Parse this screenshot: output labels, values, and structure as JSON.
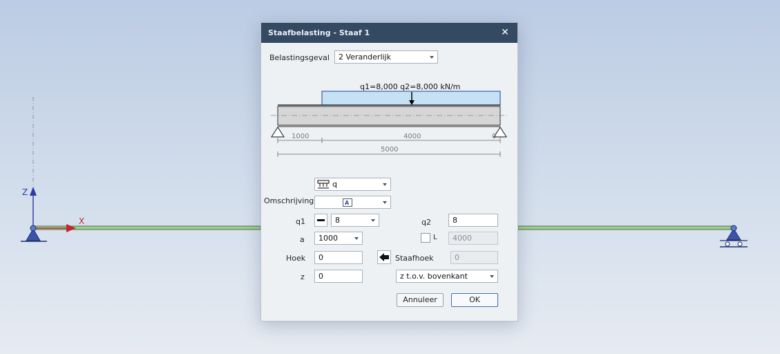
{
  "dialog": {
    "title": "Staafbelasting - Staaf 1",
    "close_label": "✕"
  },
  "scene": {
    "axis_x": "X",
    "axis_z": "Z"
  },
  "form": {
    "belastingsgeval_label": "Belastingsgeval",
    "belastingsgeval_value": "2 Veranderlijk",
    "load_type_value": "q",
    "omschrijving_label": "Omschrijving",
    "q1_label": "q1",
    "q1_value": "8",
    "q2_label": "q2",
    "q2_value": "8",
    "a_label": "a",
    "a_value": "1000",
    "L_label": "L",
    "L_value": "4000",
    "hoek_label": "Hoek",
    "hoek_value": "0",
    "staafhoek_label": "Staafhoek",
    "staafhoek_value": "0",
    "z_label": "z",
    "z_value": "0",
    "z_ref_value": "z t.o.v. bovenkant"
  },
  "diagram": {
    "load_text": "q1=8,000 q2=8,000 kN/m",
    "dim_a": "1000",
    "dim_loaded": "4000",
    "dim_end": "0",
    "dim_total": "5000"
  },
  "buttons": {
    "cancel": "Annuleer",
    "ok": "OK"
  },
  "colors": {
    "titlebar": "#344a63",
    "load_fill": "#c6e1f3",
    "load_stroke": "#1f3f9c",
    "member_green": "#9ccf8a",
    "support_blue": "#2e4a9e",
    "x_axis_red": "#c0272d"
  }
}
